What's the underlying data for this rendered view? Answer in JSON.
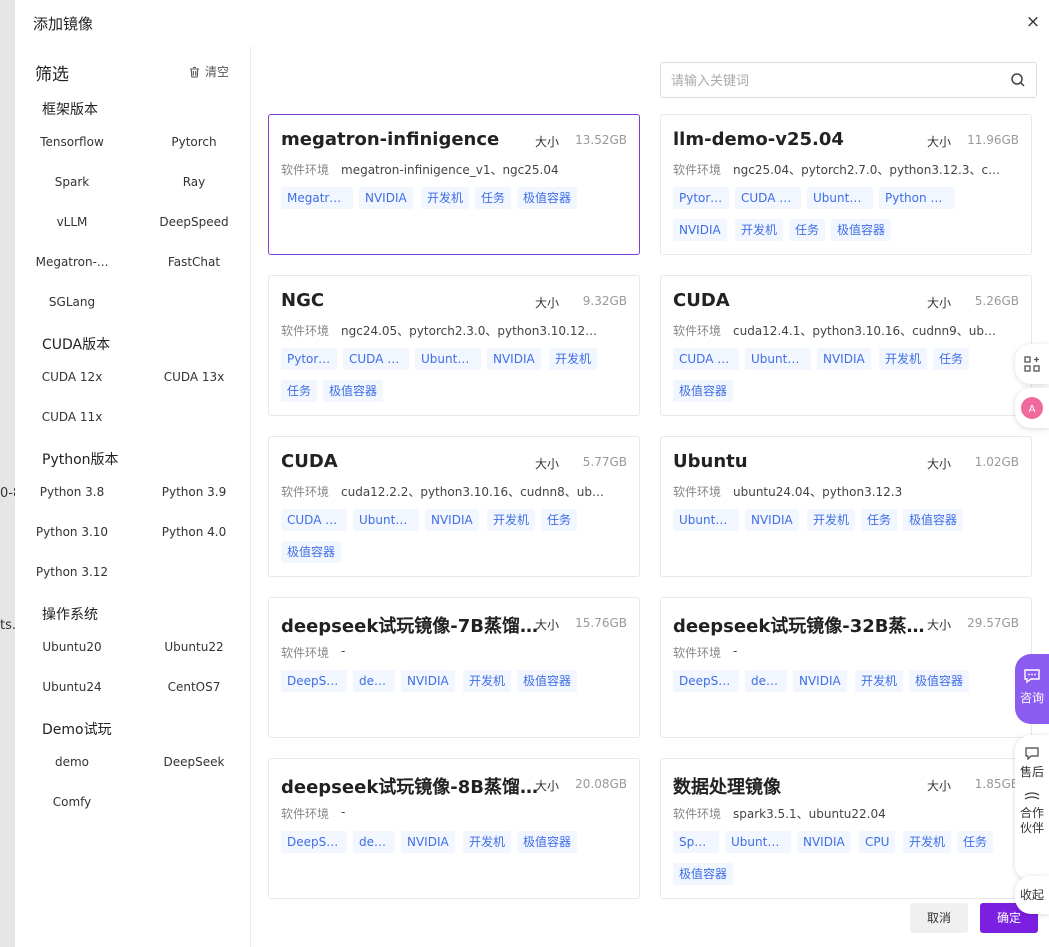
{
  "background": {
    "fragments": [
      "0-8",
      "ts..."
    ]
  },
  "modal": {
    "title": "添加镜像",
    "close_icon": "×"
  },
  "filter": {
    "title": "筛选",
    "clear_label": "清空",
    "sections": [
      {
        "title": "框架版本",
        "options": [
          "Tensorflow",
          "Pytorch",
          "Spark",
          "Ray",
          "vLLM",
          "DeepSpeed",
          "Megatron-...",
          "FastChat",
          "SGLang"
        ]
      },
      {
        "title": "CUDA版本",
        "options": [
          "CUDA 12x",
          "CUDA 13x",
          "CUDA 11x"
        ]
      },
      {
        "title": "Python版本",
        "options": [
          "Python 3.8",
          "Python 3.9",
          "Python 3.10",
          "Python 4.0",
          "Python 3.12"
        ]
      },
      {
        "title": "操作系统",
        "options": [
          "Ubuntu20",
          "Ubuntu22",
          "Ubuntu24",
          "CentOS7"
        ]
      },
      {
        "title": "Demo试玩",
        "options": [
          "demo",
          "DeepSeek",
          "Comfy"
        ]
      }
    ]
  },
  "search": {
    "placeholder": "请输入关键词",
    "value": ""
  },
  "labels": {
    "size": "大小",
    "env": "软件环境"
  },
  "cards": [
    {
      "title": "megatron-infinigence",
      "size": "13.52GB",
      "env": "megatron-infinigence_v1、ngc25.04",
      "tags": [
        "Megatron...",
        "NVIDIA",
        "开发机",
        "任务",
        "极值容器"
      ],
      "selected": true
    },
    {
      "title": "llm-demo-v25.04",
      "size": "11.96GB",
      "env": "ngc25.04、pytorch2.7.0、python3.12.3、cud...",
      "tags": [
        "Pytorch",
        "CUDA 12x",
        "Ubuntu24",
        "Python 3....",
        "NVIDIA",
        "开发机",
        "任务",
        "极值容器"
      ],
      "selected": false
    },
    {
      "title": "NGC",
      "size": "9.32GB",
      "env": "ngc24.05、pytorch2.3.0、python3.10.12、cu...",
      "tags": [
        "Pytorch",
        "CUDA 12x",
        "Ubuntu22",
        "NVIDIA",
        "开发机",
        "任务",
        "极值容器"
      ],
      "selected": false
    },
    {
      "title": "CUDA",
      "size": "5.26GB",
      "env": "cuda12.4.1、python3.10.16、cudnn9、ubunt...",
      "tags": [
        "CUDA 12x",
        "Ubuntu22",
        "NVIDIA",
        "开发机",
        "任务",
        "极值容器"
      ],
      "selected": false
    },
    {
      "title": "CUDA",
      "size": "5.77GB",
      "env": "cuda12.2.2、python3.10.16、cudnn8、ubunt...",
      "tags": [
        "CUDA 12x",
        "Ubuntu22",
        "NVIDIA",
        "开发机",
        "任务",
        "极值容器"
      ],
      "selected": false
    },
    {
      "title": "Ubuntu",
      "size": "1.02GB",
      "env": "ubuntu24.04、python3.12.3",
      "tags": [
        "Ubuntu24",
        "NVIDIA",
        "开发机",
        "任务",
        "极值容器"
      ],
      "selected": false
    },
    {
      "title": "deepseek试玩镜像-7B蒸馏-...",
      "size": "15.76GB",
      "env": "-",
      "tags": [
        "DeepSeek",
        "demo",
        "NVIDIA",
        "开发机",
        "极值容器"
      ],
      "selected": false
    },
    {
      "title": "deepseek试玩镜像-32B蒸馏...",
      "size": "29.57GB",
      "env": "-",
      "tags": [
        "DeepSeek",
        "demo",
        "NVIDIA",
        "开发机",
        "极值容器"
      ],
      "selected": false
    },
    {
      "title": "deepseek试玩镜像-8B蒸馏-...",
      "size": "20.08GB",
      "env": "-",
      "tags": [
        "DeepSeek",
        "demo",
        "NVIDIA",
        "开发机",
        "极值容器"
      ],
      "selected": false
    },
    {
      "title": "数据处理镜像",
      "size": "1.85GB",
      "env": "spark3.5.1、ubuntu22.04",
      "tags": [
        "Spark",
        "Ubuntu22",
        "NVIDIA",
        "CPU",
        "开发机",
        "任务",
        "极值容器"
      ],
      "selected": false
    }
  ],
  "float_tools": {
    "apps_icon": "apps-icon",
    "translate_icon": "translate-icon",
    "consult_label": "咨询",
    "after_sales_label": "售后",
    "partner_label": "合作\n伙伴",
    "collapse_label": "收起"
  },
  "footer": {
    "cancel_label": "取消",
    "confirm_label": "确定"
  },
  "colors": {
    "accent": "#7b1fe0",
    "selected_border": "#7c3fd6",
    "tag_text": "#3e6ee6",
    "tag_bg": "#f2f6ff",
    "consult_bg": "#8c5cf0"
  }
}
